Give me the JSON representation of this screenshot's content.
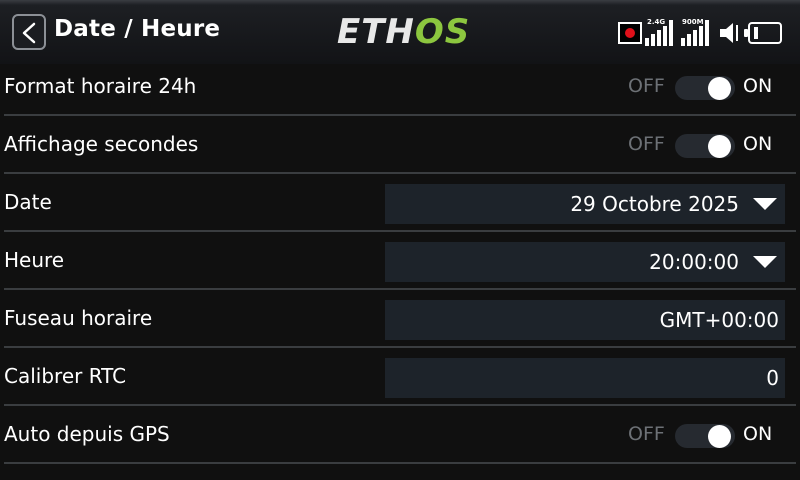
{
  "header": {
    "title": "Date / Heure",
    "logo": {
      "part1": "ETH",
      "part2": "OS"
    },
    "status": {
      "signal1_label": "2.4G",
      "signal2_label": "900M",
      "record_icon": "record-icon",
      "speaker_icon": "speaker-icon",
      "battery_icon": "battery-icon"
    }
  },
  "colors": {
    "background": "#101010",
    "field": "#1d232a",
    "separator": "#3a3d40",
    "logo_accent": "#8cc63f",
    "record": "#e0101a"
  },
  "rows": [
    {
      "label": "Format horaire 24h",
      "type": "toggle",
      "off": "OFF",
      "on": "ON",
      "state": "on"
    },
    {
      "label": "Affichage secondes",
      "type": "toggle",
      "off": "OFF",
      "on": "ON",
      "state": "on"
    },
    {
      "label": "Date",
      "type": "dropdown",
      "value": "29 Octobre 2025"
    },
    {
      "label": "Heure",
      "type": "dropdown",
      "value": "20:00:00"
    },
    {
      "label": "Fuseau horaire",
      "type": "field",
      "value": "GMT+00:00"
    },
    {
      "label": "Calibrer RTC",
      "type": "field",
      "value": "0"
    },
    {
      "label": "Auto depuis GPS",
      "type": "toggle",
      "off": "OFF",
      "on": "ON",
      "state": "on"
    }
  ]
}
